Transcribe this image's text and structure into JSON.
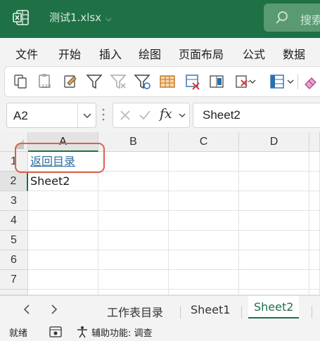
{
  "window": {
    "file_title": "测试1.xlsx",
    "search_placeholder": "搜索"
  },
  "menu": {
    "items": [
      "文件",
      "开始",
      "插入",
      "绘图",
      "页面布局",
      "公式",
      "数据"
    ]
  },
  "ribbon": {
    "icons": [
      "copy-icon",
      "paste-number-icon",
      "format-painter-icon",
      "filter-icon",
      "clear-filter-icon",
      "advanced-filter-icon",
      "table-icon",
      "delete-table-icon",
      "merge-icon",
      "delete-rows-icon",
      "insert-columns-icon",
      "eraser-icon"
    ]
  },
  "formula_bar": {
    "name_box": "A2",
    "fx_label": "fx",
    "content": "Sheet2"
  },
  "grid": {
    "columns": [
      "A",
      "B",
      "C",
      "D"
    ],
    "rows": [
      "1",
      "2",
      "3",
      "4",
      "5",
      "6",
      "7"
    ],
    "cells": {
      "A1": "返回目录",
      "A2": "Sheet2"
    }
  },
  "sheets": {
    "tabs": [
      "工作表目录",
      "Sheet1",
      "Sheet2"
    ],
    "active": "Sheet2"
  },
  "status": {
    "ready": "就绪",
    "accessibility": "辅助功能: 调查"
  },
  "colors": {
    "accent": "#1e7145",
    "link": "#2f6f9f",
    "annotation": "#d9634a"
  }
}
